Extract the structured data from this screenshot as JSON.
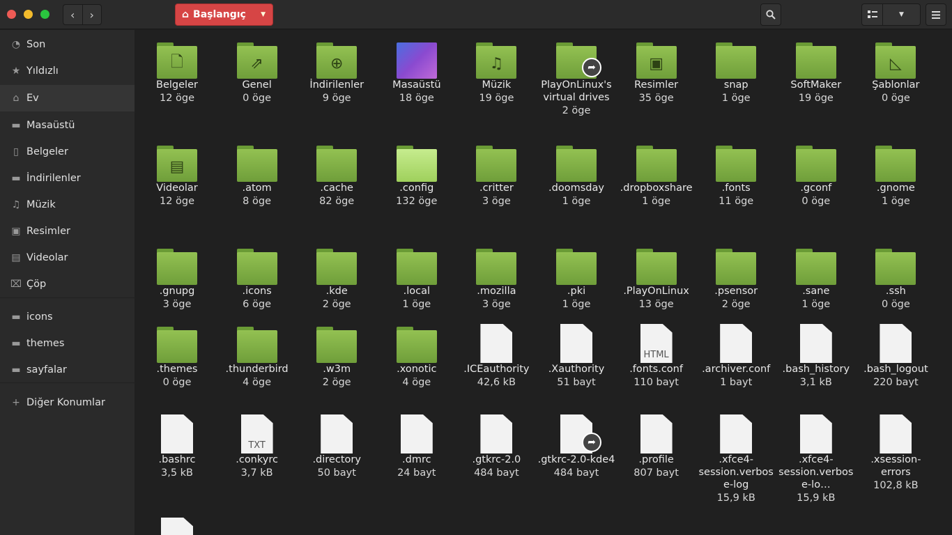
{
  "location": {
    "label": "Başlangıç"
  },
  "sidebar": [
    {
      "label": "Son",
      "icon": "clock-icon",
      "glyph": "◔"
    },
    {
      "label": "Yıldızlı",
      "icon": "star-icon",
      "glyph": "★"
    },
    {
      "label": "Ev",
      "icon": "home-icon",
      "glyph": "⌂"
    },
    {
      "label": "Masaüstü",
      "icon": "folder-icon",
      "glyph": "▬"
    },
    {
      "label": "Belgeler",
      "icon": "document-icon",
      "glyph": "▯"
    },
    {
      "label": "İndirilenler",
      "icon": "folder-icon",
      "glyph": "▬"
    },
    {
      "label": "Müzik",
      "icon": "music-icon",
      "glyph": "♫"
    },
    {
      "label": "Resimler",
      "icon": "picture-icon",
      "glyph": "▣"
    },
    {
      "label": "Videolar",
      "icon": "film-icon",
      "glyph": "▤"
    },
    {
      "label": "Çöp",
      "icon": "trash-icon",
      "glyph": "⌧"
    },
    {
      "label": "icons",
      "icon": "folder-icon",
      "glyph": "▬"
    },
    {
      "label": "themes",
      "icon": "folder-icon",
      "glyph": "▬"
    },
    {
      "label": "sayfalar",
      "icon": "folder-icon",
      "glyph": "▬"
    },
    {
      "label": "Diğer Konumlar",
      "icon": "plus-icon",
      "glyph": "+"
    }
  ],
  "items": [
    {
      "name": "Belgeler",
      "size": "12 öge",
      "kind": "folder",
      "sym": "🗋"
    },
    {
      "name": "Genel",
      "size": "0 öge",
      "kind": "folder",
      "sym": "⇗"
    },
    {
      "name": "İndirilenler",
      "size": "9 öge",
      "kind": "folder",
      "sym": "⊕"
    },
    {
      "name": "Masaüstü",
      "size": "18 öge",
      "kind": "thumb"
    },
    {
      "name": "Müzik",
      "size": "19 öge",
      "kind": "folder",
      "sym": "♫"
    },
    {
      "name": "PlayOnLinux's virtual drives",
      "size": "2 öge",
      "kind": "folder",
      "sym": "",
      "link": true
    },
    {
      "name": "Resimler",
      "size": "35 öge",
      "kind": "folder",
      "sym": "▣"
    },
    {
      "name": "snap",
      "size": "1 öge",
      "kind": "folder",
      "sym": ""
    },
    {
      "name": "SoftMaker",
      "size": "19 öge",
      "kind": "folder",
      "sym": ""
    },
    {
      "name": "Şablonlar",
      "size": "0 öge",
      "kind": "folder",
      "sym": "◺"
    },
    {
      "name": "Videolar",
      "size": "12 öge",
      "kind": "folder",
      "sym": "▤"
    },
    {
      "name": ".atom",
      "size": "8 öge",
      "kind": "folder",
      "sym": ""
    },
    {
      "name": ".cache",
      "size": "82 öge",
      "kind": "folder",
      "sym": ""
    },
    {
      "name": ".config",
      "size": "132 öge",
      "kind": "folder",
      "sym": "",
      "light": true
    },
    {
      "name": ".critter",
      "size": "3 öge",
      "kind": "folder",
      "sym": ""
    },
    {
      "name": ".doomsday",
      "size": "1 öge",
      "kind": "folder",
      "sym": ""
    },
    {
      "name": ".dropboxshare",
      "size": "1 öge",
      "kind": "folder",
      "sym": ""
    },
    {
      "name": ".fonts",
      "size": "11 öge",
      "kind": "folder",
      "sym": ""
    },
    {
      "name": ".gconf",
      "size": "0 öge",
      "kind": "folder",
      "sym": ""
    },
    {
      "name": ".gnome",
      "size": "1 öge",
      "kind": "folder",
      "sym": ""
    },
    {
      "name": ".gnupg",
      "size": "3 öge",
      "kind": "folder",
      "sym": ""
    },
    {
      "name": ".icons",
      "size": "6 öge",
      "kind": "folder",
      "sym": ""
    },
    {
      "name": ".kde",
      "size": "2 öge",
      "kind": "folder",
      "sym": ""
    },
    {
      "name": ".local",
      "size": "1 öge",
      "kind": "folder",
      "sym": ""
    },
    {
      "name": ".mozilla",
      "size": "3 öge",
      "kind": "folder",
      "sym": ""
    },
    {
      "name": ".pki",
      "size": "1 öge",
      "kind": "folder",
      "sym": ""
    },
    {
      "name": ".PlayOnLinux",
      "size": "13 öge",
      "kind": "folder",
      "sym": ""
    },
    {
      "name": ".psensor",
      "size": "2 öge",
      "kind": "folder",
      "sym": ""
    },
    {
      "name": ".sane",
      "size": "1 öge",
      "kind": "folder",
      "sym": ""
    },
    {
      "name": ".ssh",
      "size": "0 öge",
      "kind": "folder",
      "sym": ""
    },
    {
      "name": ".themes",
      "size": "0 öge",
      "kind": "folder",
      "sym": ""
    },
    {
      "name": ".thunderbird",
      "size": "4 öge",
      "kind": "folder",
      "sym": ""
    },
    {
      "name": ".w3m",
      "size": "2 öge",
      "kind": "folder",
      "sym": ""
    },
    {
      "name": ".xonotic",
      "size": "4 öge",
      "kind": "folder",
      "sym": ""
    },
    {
      "name": ".ICEauthority",
      "size": "42,6 kB",
      "kind": "file",
      "lab": ""
    },
    {
      "name": ".Xauthority",
      "size": "51 bayt",
      "kind": "file",
      "lab": ""
    },
    {
      "name": ".fonts.conf",
      "size": "110 bayt",
      "kind": "file",
      "lab": "HTML"
    },
    {
      "name": ".archiver.conf",
      "size": "1 bayt",
      "kind": "file",
      "lab": ""
    },
    {
      "name": ".bash_history",
      "size": "3,1 kB",
      "kind": "file",
      "lab": ""
    },
    {
      "name": ".bash_logout",
      "size": "220 bayt",
      "kind": "file",
      "lab": ""
    },
    {
      "name": ".bashrc",
      "size": "3,5 kB",
      "kind": "file",
      "lab": ""
    },
    {
      "name": ".conkyrc",
      "size": "3,7 kB",
      "kind": "file",
      "lab": "TXT"
    },
    {
      "name": ".directory",
      "size": "50 bayt",
      "kind": "file",
      "lab": ""
    },
    {
      "name": ".dmrc",
      "size": "24 bayt",
      "kind": "file",
      "lab": ""
    },
    {
      "name": ".gtkrc-2.0",
      "size": "484 bayt",
      "kind": "file",
      "lab": ""
    },
    {
      "name": ".gtkrc-2.0-kde4",
      "size": "484 bayt",
      "kind": "file",
      "lab": "",
      "link": true
    },
    {
      "name": ".profile",
      "size": "807 bayt",
      "kind": "file",
      "lab": ""
    },
    {
      "name": ".xfce4-session.verbose-log",
      "size": "15,9 kB",
      "kind": "file",
      "lab": ""
    },
    {
      "name": ".xfce4-session.verbose-lo…",
      "size": "15,9 kB",
      "kind": "file",
      "lab": ""
    },
    {
      "name": ".xsession-errors",
      "size": "102,8 kB",
      "kind": "file",
      "lab": ""
    },
    {
      "name": "",
      "size": "",
      "kind": "file",
      "lab": "</>"
    }
  ]
}
